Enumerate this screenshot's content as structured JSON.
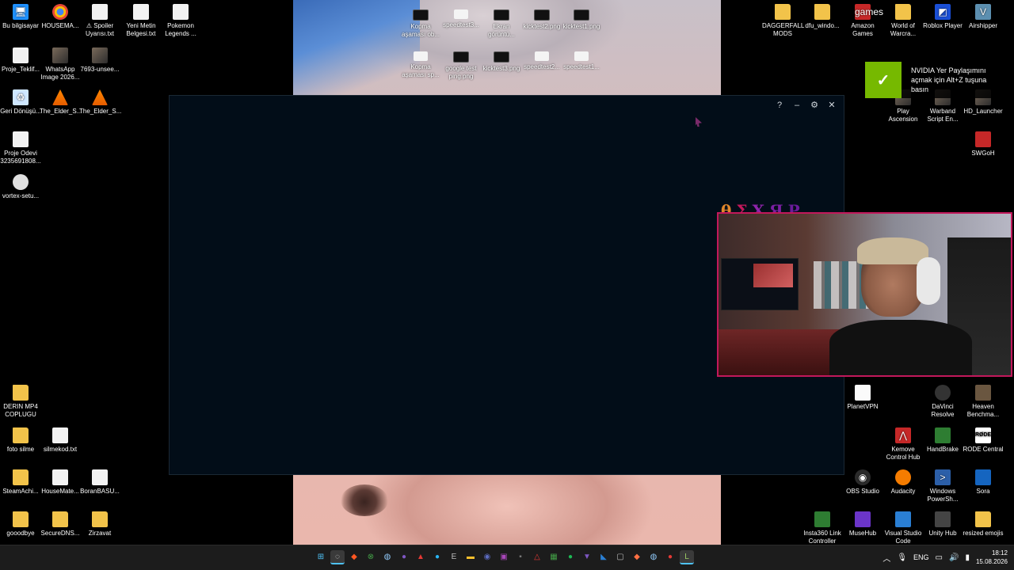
{
  "desktop": {
    "left_icons": [
      {
        "label": "Bu bilgisayar",
        "icon": "pc-icon",
        "glyph": "🖥",
        "kind": "pc"
      },
      {
        "label": "HOUSEMA...",
        "icon": "chrome-icon",
        "glyph": "",
        "kind": "chrome"
      },
      {
        "label": "⚠ Spoiler Uyarısı.txt",
        "icon": "text-file-icon",
        "glyph": "",
        "kind": "doc"
      },
      {
        "label": "Yeni Metin Belgesi.txt",
        "icon": "text-file-icon",
        "glyph": "",
        "kind": "doc"
      },
      {
        "label": "Pokemon Legends ...",
        "icon": "text-file-icon",
        "glyph": "",
        "kind": "doc"
      },
      {
        "label": "Proje_Teklif...",
        "icon": "document-icon",
        "glyph": "",
        "kind": "doc"
      },
      {
        "label": "WhatsApp Image 2026...",
        "icon": "image-icon",
        "glyph": "",
        "kind": "img"
      },
      {
        "label": "7693-unsee...",
        "icon": "image-icon",
        "glyph": "",
        "kind": "img"
      },
      {
        "label": "Geri Dönüşü...",
        "icon": "recycle-bin-icon",
        "glyph": "♻",
        "kind": "bin"
      },
      {
        "label": "The_Elder_S...",
        "icon": "vlc-icon",
        "glyph": "",
        "kind": "vlc"
      },
      {
        "label": "The_Elder_S...",
        "icon": "vlc-icon",
        "glyph": "",
        "kind": "vlc"
      },
      {
        "label": "Proje Odevi 3235691808...",
        "icon": "document-icon",
        "glyph": "",
        "kind": "doc"
      },
      {
        "label": "vortex-setu...",
        "icon": "installer-icon",
        "glyph": "",
        "kind": "vortex"
      },
      {
        "label": "DERIN MP4 COPLUGU",
        "icon": "folder-icon",
        "glyph": "",
        "kind": "folder"
      },
      {
        "label": "foto silme",
        "icon": "folder-icon",
        "glyph": "",
        "kind": "folder"
      },
      {
        "label": "silmekod.txt",
        "icon": "text-file-icon",
        "glyph": "",
        "kind": "doc"
      },
      {
        "label": "SteamAchi...",
        "icon": "folder-icon",
        "glyph": "",
        "kind": "folder"
      },
      {
        "label": "HouseMate...",
        "icon": "text-file-icon",
        "glyph": "",
        "kind": "doc"
      },
      {
        "label": "BoranBASU...",
        "icon": "text-file-icon",
        "glyph": "",
        "kind": "doc"
      },
      {
        "label": "gooodbye",
        "icon": "folder-icon",
        "glyph": "",
        "kind": "folder"
      },
      {
        "label": "SecureDNS...",
        "icon": "folder-icon",
        "glyph": "",
        "kind": "folder"
      },
      {
        "label": "Zirzavat",
        "icon": "folder-icon",
        "glyph": "",
        "kind": "folder"
      }
    ],
    "top_icons": [
      {
        "label": "Kopma aşaması ob...",
        "icon": "screenshot-file-icon",
        "kind": "dark"
      },
      {
        "label": "speedtest3...",
        "icon": "screenshot-file-icon",
        "kind": "white"
      },
      {
        "label": "Ekran görüntü...",
        "icon": "screenshot-file-icon",
        "kind": "dark"
      },
      {
        "label": "kicktest2.png",
        "icon": "screenshot-file-icon",
        "kind": "dark"
      },
      {
        "label": "kicktest1.png",
        "icon": "screenshot-file-icon",
        "kind": "dark"
      },
      {
        "label": "Kopma aşaması sp...",
        "icon": "screenshot-file-icon",
        "kind": "white"
      },
      {
        "label": "google test ping.png",
        "icon": "screenshot-file-icon",
        "kind": "dark"
      },
      {
        "label": "kicktest3.png",
        "icon": "screenshot-file-icon",
        "kind": "dark"
      },
      {
        "label": "speedtest2...",
        "icon": "screenshot-file-icon",
        "kind": "white"
      },
      {
        "label": "speedtest1...",
        "icon": "screenshot-file-icon",
        "kind": "white"
      }
    ],
    "right_icons": [
      {
        "label": "DAGGERFALL MODS",
        "icon": "folder-icon",
        "glyph": "",
        "kind": "folder"
      },
      {
        "label": "dfu_windo...",
        "icon": "app-icon",
        "glyph": "",
        "kind": "folder"
      },
      {
        "label": "Amazon Games",
        "icon": "amazon-games-icon",
        "glyph": "games",
        "kind": "red"
      },
      {
        "label": "World of Warcra...",
        "icon": "folder-icon",
        "glyph": "",
        "kind": "folder"
      },
      {
        "label": "Roblox Player",
        "icon": "roblox-icon",
        "glyph": "◩",
        "kind": "roblox"
      },
      {
        "label": "Airshipper",
        "icon": "airshipper-icon",
        "glyph": "V",
        "kind": "air"
      },
      {
        "label": "Play Ascension",
        "icon": "ascension-icon",
        "glyph": "",
        "kind": "img"
      },
      {
        "label": "Warband Script En...",
        "icon": "app-icon",
        "glyph": "",
        "kind": "img"
      },
      {
        "label": "HD_Launcher",
        "icon": "app-icon",
        "glyph": "",
        "kind": "img"
      },
      {
        "label": "SWGoH",
        "icon": "swgoh-icon",
        "glyph": "",
        "kind": "red"
      },
      {
        "label": "PlanetVPN",
        "icon": "text-file-icon",
        "glyph": "",
        "kind": "planet"
      },
      {
        "label": "DaVinci Resolve",
        "icon": "davinci-icon",
        "glyph": "",
        "kind": "dav"
      },
      {
        "label": "Heaven Benchma...",
        "icon": "heaven-icon",
        "glyph": "",
        "kind": "heaven"
      },
      {
        "label": "Kemove Control Hub",
        "icon": "kemove-icon",
        "glyph": "⋀",
        "kind": "red"
      },
      {
        "label": "HandBrake",
        "icon": "handbrake-icon",
        "glyph": "",
        "kind": "green"
      },
      {
        "label": "RODE Central",
        "icon": "rode-icon",
        "glyph": "RØDE",
        "kind": "rode"
      },
      {
        "label": "OBS Studio",
        "icon": "obs-icon",
        "glyph": "◉",
        "kind": "obs"
      },
      {
        "label": "Audacity",
        "icon": "audacity-icon",
        "glyph": "",
        "kind": "aud"
      },
      {
        "label": "Windows PowerSh...",
        "icon": "powershell-icon",
        "glyph": ">",
        "kind": "ps"
      },
      {
        "label": "Sora",
        "icon": "sora-icon",
        "glyph": "",
        "kind": "sora"
      },
      {
        "label": "Insta360 Link Controller",
        "icon": "insta360-icon",
        "glyph": "",
        "kind": "green"
      },
      {
        "label": "MuseHub",
        "icon": "musehub-icon",
        "glyph": "",
        "kind": "muse"
      },
      {
        "label": "Visual Studio Code",
        "icon": "vscode-icon",
        "glyph": "",
        "kind": "vs"
      },
      {
        "label": "Unity Hub",
        "icon": "unity-hub-icon",
        "glyph": "",
        "kind": "unity"
      },
      {
        "label": "resized emojis",
        "icon": "folder-icon",
        "glyph": "",
        "kind": "folder"
      }
    ]
  },
  "app_window": {
    "help": "?",
    "minimize": "–",
    "settings": "⚙",
    "close": "✕"
  },
  "nvidia_toast": {
    "logo": "✓",
    "message": "NVIDIA Yer Paylaşımını açmak için Alt+Z tuşuna basın"
  },
  "overlay": {
    "title_glyphs": [
      "θ",
      "Σ",
      "Χ",
      "Я",
      "P"
    ],
    "title_colors": [
      "#e0862a",
      "#c2185b",
      "#8e24aa",
      "#7b1fa2",
      "#6a1b9a"
    ]
  },
  "taskbar": {
    "apps": [
      {
        "name": "start-button",
        "glyph": "⊞",
        "color": "#4fc3f7"
      },
      {
        "name": "search-app",
        "glyph": "◌",
        "color": "#ddd",
        "active": true
      },
      {
        "name": "brave-app",
        "glyph": "◆",
        "color": "#ff5722"
      },
      {
        "name": "xbox-app",
        "glyph": "⊗",
        "color": "#43a047"
      },
      {
        "name": "steam-app",
        "glyph": "◍",
        "color": "#90caf9"
      },
      {
        "name": "app-purple",
        "glyph": "●",
        "color": "#7e57c2"
      },
      {
        "name": "app-red",
        "glyph": "▲",
        "color": "#e53935"
      },
      {
        "name": "app-blue",
        "glyph": "●",
        "color": "#29b6f6"
      },
      {
        "name": "app-epic",
        "glyph": "E",
        "color": "#bbb"
      },
      {
        "name": "file-explorer",
        "glyph": "▬",
        "color": "#fbc02d"
      },
      {
        "name": "discord-app",
        "glyph": "◉",
        "color": "#5c6bc0"
      },
      {
        "name": "app-twitch",
        "glyph": "▣",
        "color": "#ab47bc"
      },
      {
        "name": "app-dark",
        "glyph": "▪",
        "color": "#777"
      },
      {
        "name": "app-triangle",
        "glyph": "△",
        "color": "#e53935"
      },
      {
        "name": "app-green",
        "glyph": "▦",
        "color": "#43a047"
      },
      {
        "name": "spotify-app",
        "glyph": "●",
        "color": "#1db954"
      },
      {
        "name": "vs-app",
        "glyph": "▼",
        "color": "#7e57c2"
      },
      {
        "name": "vscode-app",
        "glyph": "◣",
        "color": "#2a7fd4"
      },
      {
        "name": "app-sq",
        "glyph": "▢",
        "color": "#bbb"
      },
      {
        "name": "brave2-app",
        "glyph": "◆",
        "color": "#ff7043"
      },
      {
        "name": "steam2-app",
        "glyph": "◍",
        "color": "#90caf9"
      },
      {
        "name": "app-red2",
        "glyph": "●",
        "color": "#e53935"
      },
      {
        "name": "app-l",
        "glyph": "L",
        "color": "#9ccc65",
        "active": true
      }
    ],
    "tray": {
      "chevron": "︿",
      "mic": "🎙",
      "lang": "ENG",
      "monitor": "▭",
      "sound": "🔊",
      "battery": "▮",
      "time": "18:12",
      "date": "15.08.2026"
    }
  }
}
